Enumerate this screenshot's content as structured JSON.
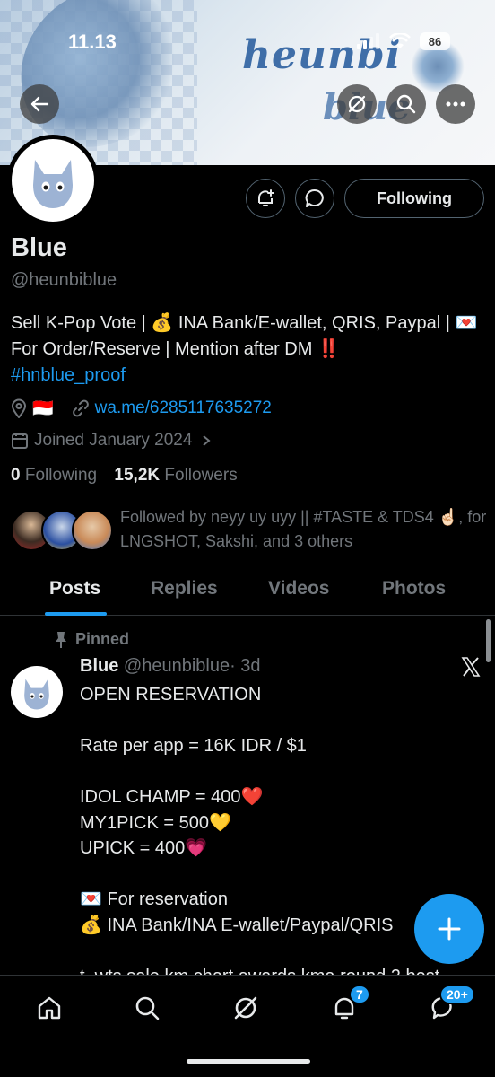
{
  "status_bar": {
    "time": "11.13",
    "battery": "86"
  },
  "banner": {
    "logo_line1": "heunbi",
    "logo_line2": "blue"
  },
  "profile": {
    "name": "Blue",
    "handle": "@heunbiblue",
    "bio_text": "Sell K-Pop Vote | 💰 INA Bank/E-wallet, QRIS, Paypal | 💌 For Order/Reserve | Mention after DM ‼️",
    "bio_hashtag": "#hnblue_proof",
    "location_flag": "🇮🇩",
    "website": "wa.me/6285117635272",
    "joined": "Joined January 2024",
    "following_count": "0",
    "following_label": "Following",
    "followers_count": "15,2K",
    "followers_label": "Followers",
    "followed_by": "Followed by neyy uy uyy || #TASTE & TDS4 ☝🏻, for LNGSHOT, Sakshi, and 3 others"
  },
  "actions": {
    "following_button": "Following"
  },
  "tabs": [
    {
      "label": "Posts",
      "active": true
    },
    {
      "label": "Replies",
      "active": false
    },
    {
      "label": "Videos",
      "active": false
    },
    {
      "label": "Photos",
      "active": false
    }
  ],
  "post": {
    "pinned_label": "Pinned",
    "author": "Blue",
    "handle": "@heunbiblue",
    "time": "· 3d",
    "body": "OPEN RESERVATION\n\nRate per app = 16K IDR / $1\n\nIDOL CHAMP = 400❤️\nMY1PICK = 500💛\nUPICK = 400💗\n\n💌 For reservation\n💰 INA Bank/INA E-wallet/Paypal/QRIS\n\nt. wts sale km chart awards kma round 2 best"
  },
  "bottom_nav": {
    "notifications_badge": "7",
    "messages_badge": "20+"
  },
  "colors": {
    "accent": "#1d9bf0",
    "background": "#000000",
    "muted": "#71767b"
  }
}
